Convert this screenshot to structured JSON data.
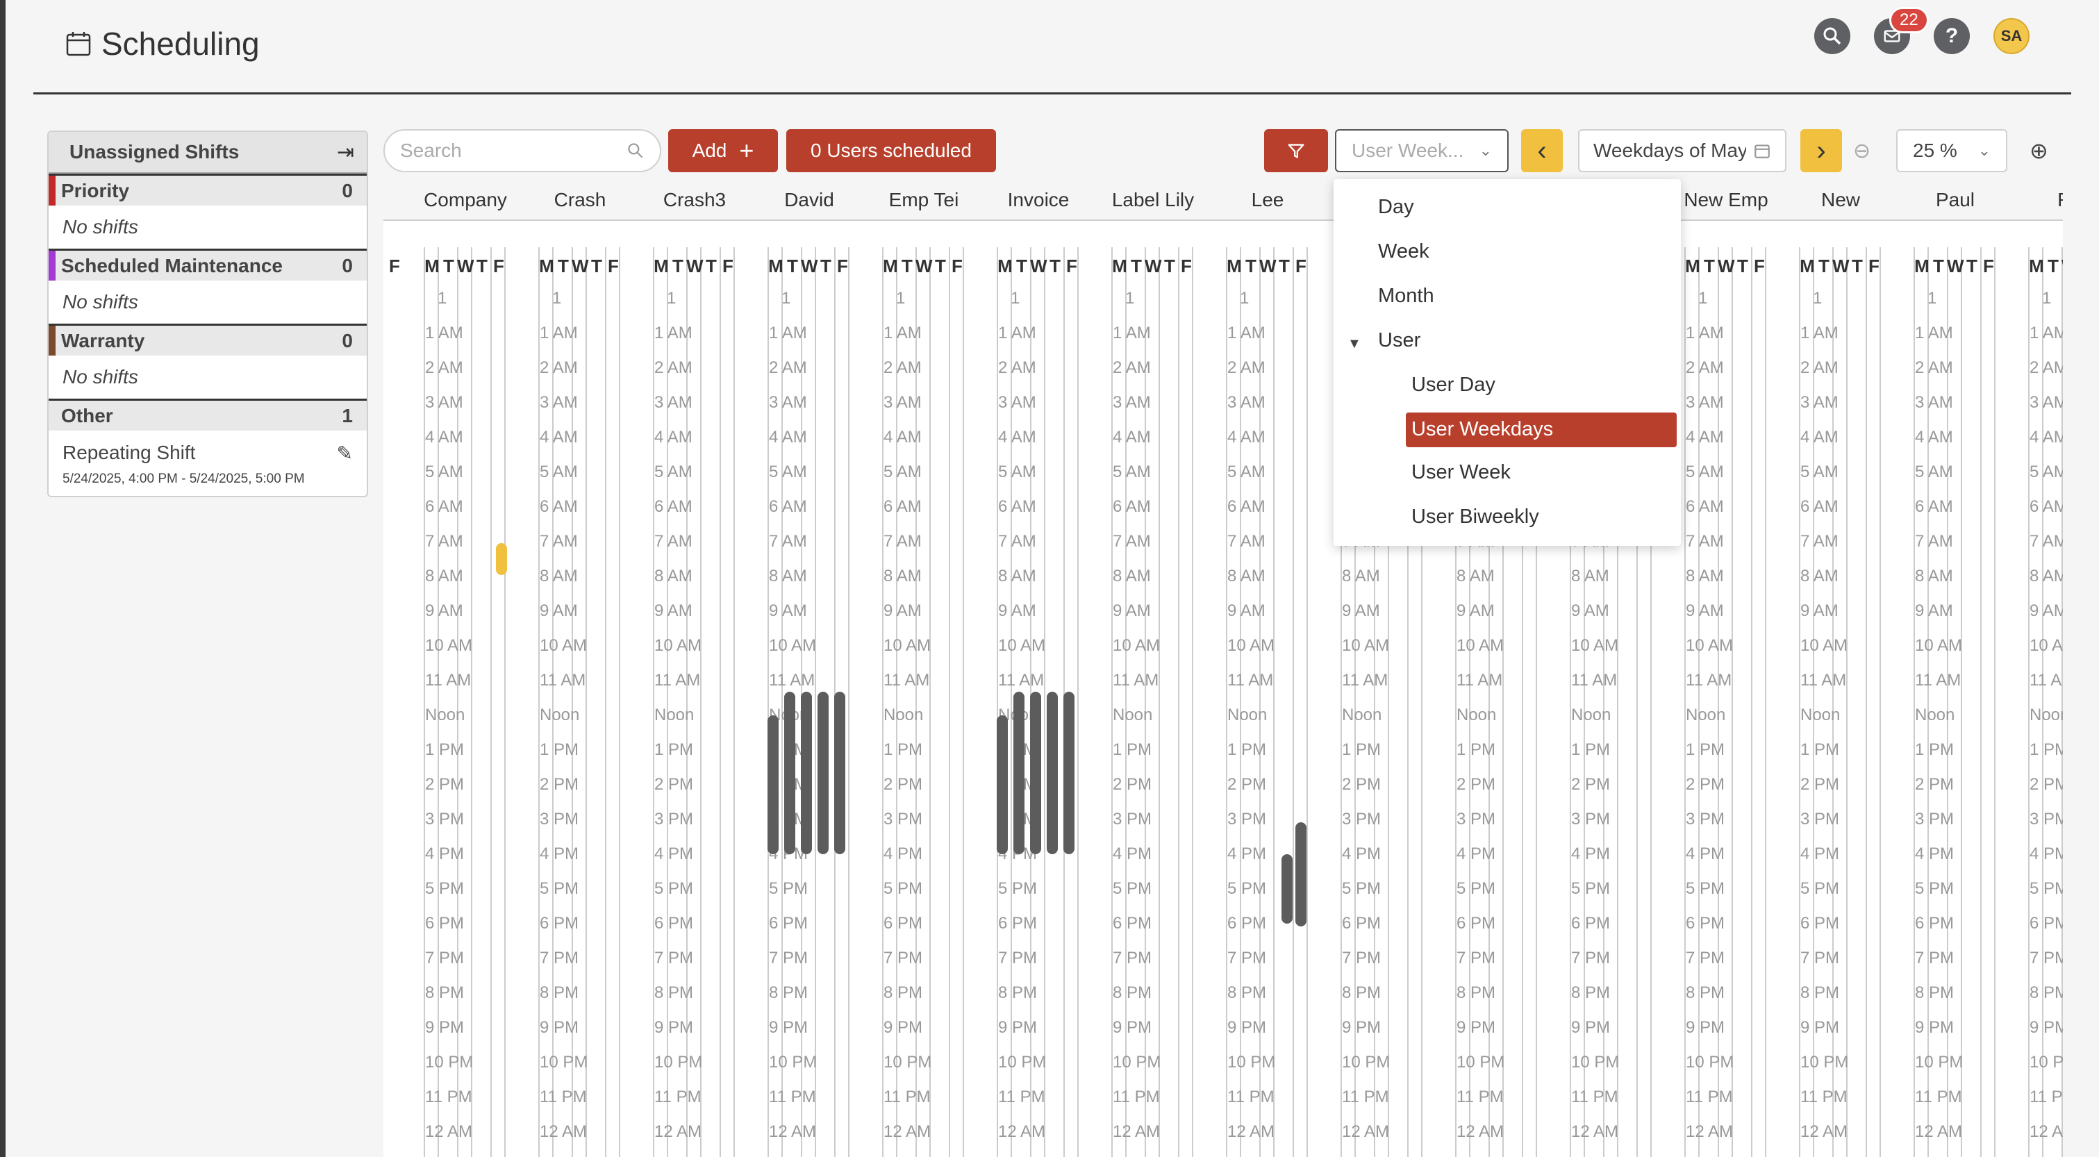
{
  "header": {
    "title": "Scheduling",
    "notifications_count": "22",
    "avatar_initials": "SA",
    "help_label": "?"
  },
  "unassigned": {
    "title": "Unassigned Shifts",
    "categories": [
      {
        "name": "Priority",
        "count": "0",
        "color": "#c42a2a",
        "empty_text": "No shifts"
      },
      {
        "name": "Scheduled Maintenance",
        "count": "0",
        "color": "#a43ad6",
        "empty_text": "No shifts"
      },
      {
        "name": "Warranty",
        "count": "0",
        "color": "#7a4a2e",
        "empty_text": "No shifts"
      },
      {
        "name": "Other",
        "count": "1",
        "color": "#e8e8e8"
      }
    ],
    "shift": {
      "title": "Repeating Shift",
      "time": "5/24/2025, 4:00 PM - 5/24/2025, 5:00 PM"
    }
  },
  "toolbar": {
    "search_placeholder": "Search",
    "add_label": "Add",
    "users_scheduled_label": "0 Users scheduled",
    "view_value": "User Week...",
    "date_value": "Weekdays of May",
    "zoom_value": "25 %"
  },
  "dropdown": {
    "items": [
      "Day",
      "Week",
      "Month",
      "User"
    ],
    "sub_items": [
      "User Day",
      "User Weekdays",
      "User Week",
      "User Biweekly"
    ],
    "selected": "User Weekdays"
  },
  "calendar": {
    "users": [
      "Company",
      "Crash",
      "Crash3",
      "David",
      "Emp Tei",
      "Invoice",
      "Label Lily",
      "Lee",
      "",
      "",
      "",
      "New Emp",
      "New",
      "Paul",
      "Ro"
    ],
    "day_letters": [
      "M",
      "T",
      "W",
      "T",
      "F"
    ],
    "hours": [
      "1",
      "1 AM",
      "2 AM",
      "3 AM",
      "4 AM",
      "5 AM",
      "6 AM",
      "7 AM",
      "8 AM",
      "9 AM",
      "10 AM",
      "11 AM",
      "Noon",
      "1 PM",
      "2 PM",
      "3 PM",
      "4 PM",
      "5 PM",
      "6 PM",
      "7 PM",
      "8 PM",
      "9 PM",
      "10 PM",
      "11 PM",
      "12 AM"
    ]
  }
}
